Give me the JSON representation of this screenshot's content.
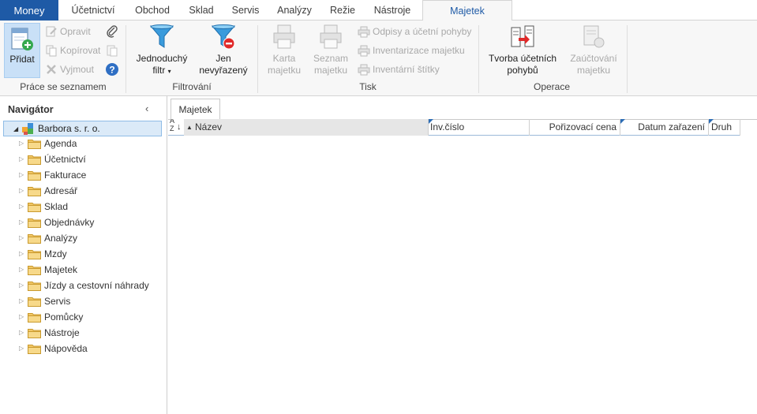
{
  "menu": {
    "tabs": [
      "Money",
      "Účetnictví",
      "Obchod",
      "Sklad",
      "Servis",
      "Analýzy",
      "Režie",
      "Nástroje",
      "Majetek"
    ],
    "active": "Majetek"
  },
  "ribbon": {
    "groups": {
      "prace": "Práce se seznamem",
      "filtrovani": "Filtrování",
      "tisk": "Tisk",
      "operace": "Operace"
    },
    "pridat": "Přidat",
    "opravit": "Opravit",
    "kopirovat": "Kopírovat",
    "vyjmout": "Vyjmout",
    "filtr_line1": "Jednoduchý",
    "filtr_line2": "filtr",
    "jen_line1": "Jen",
    "jen_line2": "nevyřazený",
    "karta_line1": "Karta",
    "karta_line2": "majetku",
    "seznam_line1": "Seznam",
    "seznam_line2": "majetku",
    "odpisy": "Odpisy a účetní pohyby",
    "inventarizace": "Inventarizace majetku",
    "stitky": "Inventární štítky",
    "tvorba_line1": "Tvorba účetních",
    "tvorba_line2": "pohybů",
    "zauct_line1": "Zaúčtování",
    "zauct_line2": "majetku"
  },
  "navigator": {
    "title": "Navigátor",
    "root": "Barbora s. r. o.",
    "items": [
      "Agenda",
      "Účetnictví",
      "Fakturace",
      "Adresář",
      "Sklad",
      "Objednávky",
      "Analýzy",
      "Mzdy",
      "Majetek",
      "Jízdy a cestovní náhrady",
      "Servis",
      "Pomůcky",
      "Nástroje",
      "Nápověda"
    ]
  },
  "main": {
    "tab": "Majetek",
    "columns": {
      "nazev": "Název",
      "inv": "Inv.číslo",
      "cena": "Pořizovací cena",
      "datum": "Datum zařazení",
      "druh": "Druh"
    }
  },
  "colors": {
    "accent": "#1e5aa6",
    "selection": "#dbeaf8",
    "folder": "#f2c766"
  }
}
